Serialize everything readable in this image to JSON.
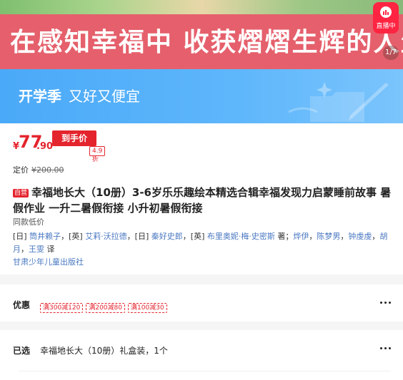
{
  "banner": {
    "headline": "在感知幸福中 收获熠熠生辉的人生",
    "page_indicator": "1/7"
  },
  "live": {
    "label": "直播中"
  },
  "promo": {
    "title": "开学季",
    "subtitle": "又好又便宜"
  },
  "price": {
    "currency": "¥",
    "integer": "77",
    "decimal": ".90",
    "hand_price_label": "到手价",
    "discount": "4.9折"
  },
  "list_price": {
    "label": "定价",
    "value": "¥200.00"
  },
  "product": {
    "self_tag": "自营",
    "title": "幸福地长大（10册）3-6岁乐乐趣绘本精选合辑幸福发现力启蒙睡前故事 暑假作业 一升二暑假衔接 小升初暑假衔接",
    "same_low": "同款低价",
    "authors": {
      "p1": "[日] ",
      "a1": "筒井赖子",
      "p2": "，[英] ",
      "a2": "艾莉·沃拉德",
      "p3": "，[日] ",
      "a3": "秦好史郎",
      "p4": "，[英] ",
      "a4": "布里奥妮·梅·史密斯",
      "p5": " 著；",
      "a5": "烨伊",
      "p6": "，",
      "a6": "陈梦男",
      "p7": "，",
      "a7": "钟虔虔",
      "p8": "，",
      "a8": "胡月",
      "p9": "，",
      "a9": "王雯",
      "p10": " 译"
    },
    "publisher": "甘肃少年儿童出版社"
  },
  "coupon": {
    "label": "优惠",
    "items": [
      "满300减120",
      "满200减80",
      "满100减30"
    ]
  },
  "selected": {
    "label": "已选",
    "value": "幸福地长大（10册）礼盒装，1个"
  },
  "colors": {
    "accent_red": "#e4242d",
    "banner_pink": "#e5606c",
    "promo_blue": "#4aa9f8",
    "link_blue": "#4a78c2"
  }
}
